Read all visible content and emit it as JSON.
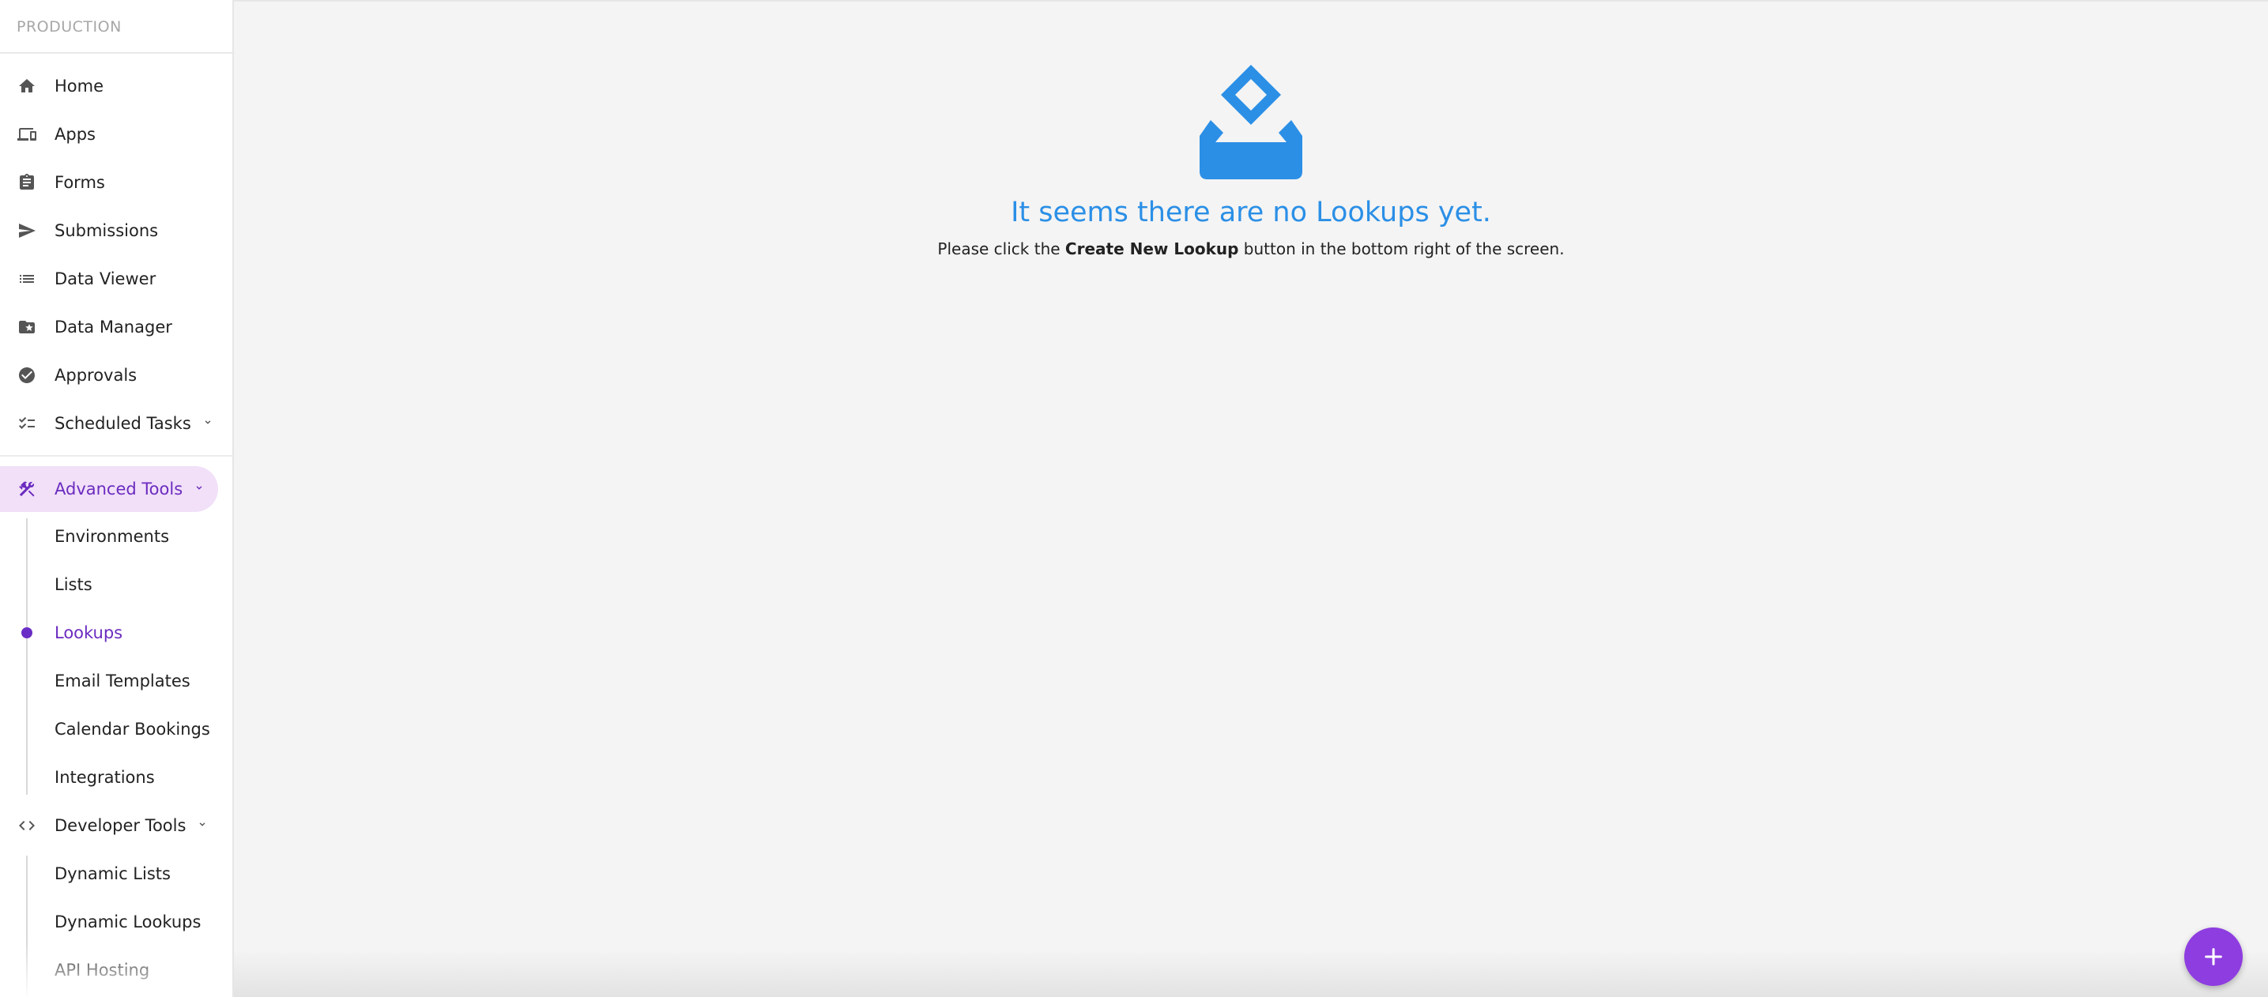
{
  "sidebar": {
    "environment": "PRODUCTION",
    "items": [
      {
        "label": "Home",
        "icon": "home-icon"
      },
      {
        "label": "Apps",
        "icon": "devices-icon"
      },
      {
        "label": "Forms",
        "icon": "clipboard-icon"
      },
      {
        "label": "Submissions",
        "icon": "send-icon"
      },
      {
        "label": "Data Viewer",
        "icon": "list-icon"
      },
      {
        "label": "Data Manager",
        "icon": "folder-star-icon"
      },
      {
        "label": "Approvals",
        "icon": "check-circle-icon"
      },
      {
        "label": "Scheduled Tasks",
        "icon": "checklist-icon"
      }
    ],
    "advanced_tools": {
      "label": "Advanced Tools",
      "icon": "tools-icon",
      "children": [
        "Environments",
        "Lists",
        "Lookups",
        "Email Templates",
        "Calendar Bookings",
        "Integrations"
      ],
      "selected": "Lookups"
    },
    "developer_tools": {
      "label": "Developer Tools",
      "icon": "code-icon",
      "children": [
        "Dynamic Lists",
        "Dynamic Lookups",
        "API Hosting"
      ]
    }
  },
  "main": {
    "empty_title": "It seems there are no Lookups yet.",
    "empty_desc_prefix": "Please click the ",
    "empty_desc_bold": "Create New Lookup",
    "empty_desc_suffix": " button in the bottom right of the screen.",
    "empty_icon": "inbox-diamond-icon"
  },
  "fab": {
    "icon": "plus-icon"
  },
  "colors": {
    "accent": "#6b2bbf",
    "active_bg": "#f1e0f8",
    "empty_blue": "#2b8fe6",
    "fab": "#8e3de0"
  }
}
